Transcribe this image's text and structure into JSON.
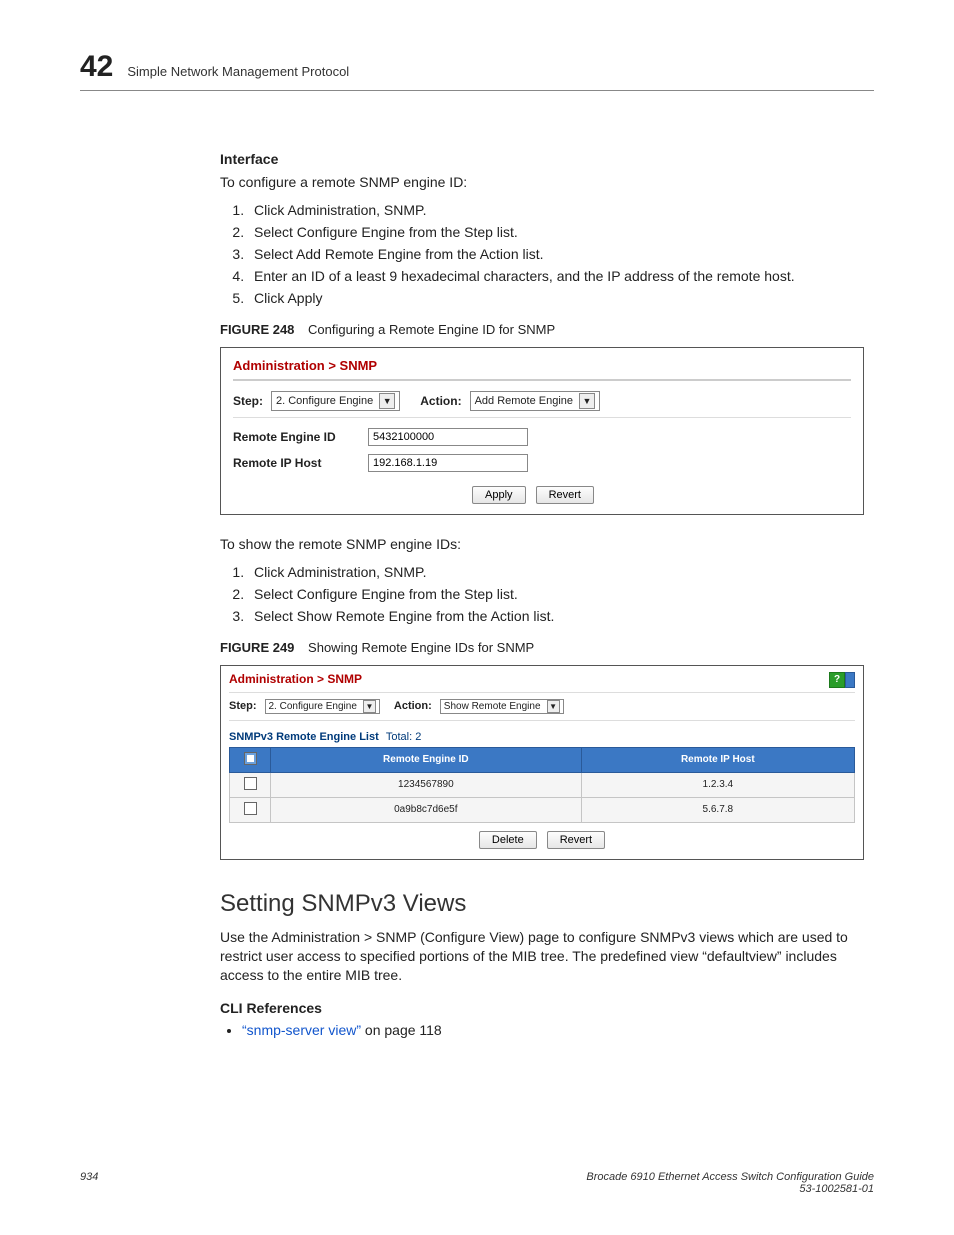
{
  "header": {
    "chapter_number": "42",
    "chapter_title": "Simple Network Management Protocol"
  },
  "section1": {
    "heading": "Interface",
    "intro": "To configure a remote SNMP engine ID:",
    "steps": [
      "Click Administration, SNMP.",
      "Select Configure Engine from the Step list.",
      "Select Add Remote Engine from the Action list.",
      "Enter an ID of a least 9 hexadecimal characters, and the IP address of the remote host.",
      "Click Apply"
    ]
  },
  "figure248": {
    "label": "FIGURE 248",
    "caption": "Configuring a Remote Engine ID for SNMP",
    "breadcrumb": "Administration > SNMP",
    "step_label": "Step:",
    "step_value": "2. Configure Engine",
    "action_label": "Action:",
    "action_value": "Add Remote Engine",
    "fields": {
      "remote_engine_id_label": "Remote Engine ID",
      "remote_engine_id_value": "5432100000",
      "remote_ip_host_label": "Remote IP Host",
      "remote_ip_host_value": "192.168.1.19"
    },
    "apply": "Apply",
    "revert": "Revert"
  },
  "section2": {
    "intro": "To show the remote SNMP engine IDs:",
    "steps": [
      "Click Administration, SNMP.",
      "Select Configure Engine from the Step list.",
      "Select Show Remote Engine from the Action list."
    ]
  },
  "figure249": {
    "label": "FIGURE 249",
    "caption": "Showing Remote Engine IDs for SNMP",
    "breadcrumb": "Administration > SNMP",
    "step_label": "Step:",
    "step_value": "2. Configure Engine",
    "action_label": "Action:",
    "action_value": "Show Remote Engine",
    "list_title": "SNMPv3 Remote Engine List",
    "total_label": "Total:",
    "total_value": "2",
    "columns": {
      "c1": "Remote Engine ID",
      "c2": "Remote IP Host"
    },
    "rows": [
      {
        "engine_id": "1234567890",
        "ip": "1.2.3.4"
      },
      {
        "engine_id": "0a9b8c7d6e5f",
        "ip": "5.6.7.8"
      }
    ],
    "delete": "Delete",
    "revert": "Revert",
    "help_q": "?"
  },
  "section3": {
    "title": "Setting SNMPv3 Views",
    "body": "Use the Administration > SNMP (Configure View) page to configure SNMPv3 views which are used to restrict user access to specified portions of the MIB tree. The predefined view “defaultview” includes access to the entire MIB tree.",
    "cli_heading": "CLI References",
    "cli_link_text": "“snmp-server view”",
    "cli_link_suffix": " on page 118"
  },
  "footer": {
    "page_number": "934",
    "book_title": "Brocade 6910 Ethernet Access Switch Configuration Guide",
    "doc_id": "53-1002581-01"
  }
}
